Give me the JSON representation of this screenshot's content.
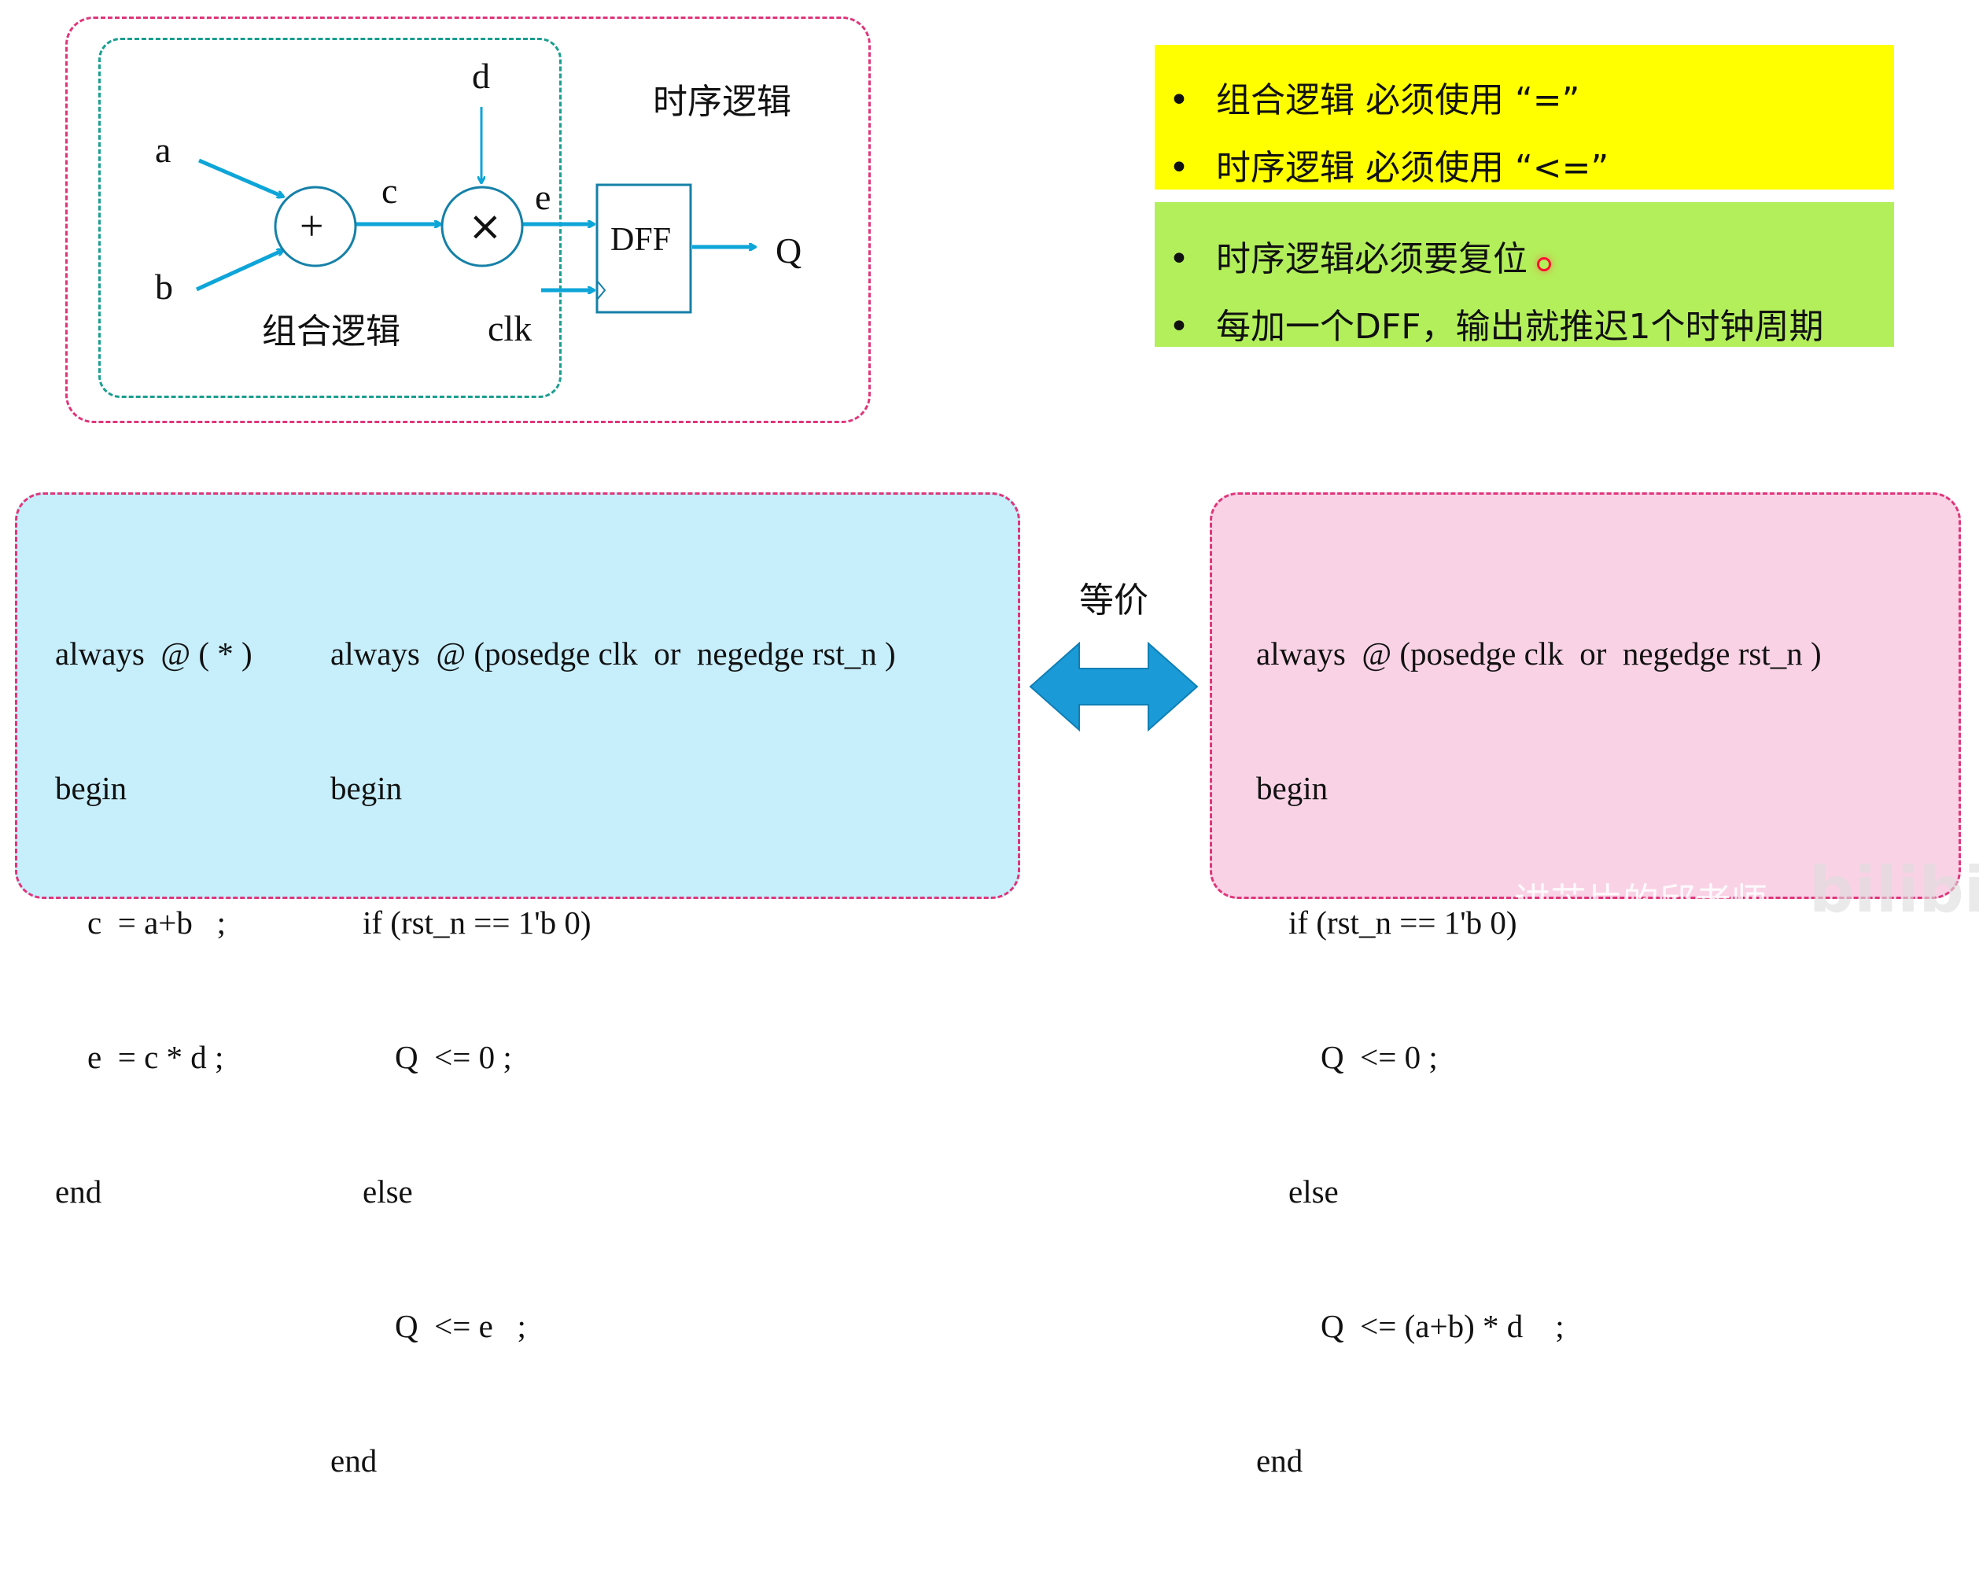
{
  "diagram": {
    "inputs": {
      "a": "a",
      "b": "b",
      "c": "c",
      "d": "d",
      "e": "e",
      "clk": "clk",
      "q": "Q"
    },
    "adder_symbol": "+",
    "multiplier_symbol": "×",
    "dff_label": "DFF",
    "combinational_label": "组合逻辑",
    "sequential_label": "时序逻辑"
  },
  "notes": {
    "yellow": [
      "组合逻辑 必须使用 “=”",
      "时序逻辑 必须使用 “<=”"
    ],
    "green": [
      "时序逻辑必须要复位",
      "每加一个DFF，输出就推迟1个时钟周期"
    ],
    "bullet": "•",
    "colors": {
      "yellow": "#ffff00",
      "green": "#b3ef5a"
    }
  },
  "left_code": {
    "comb": [
      "always  @ ( * )",
      "begin",
      "    c  = a+b   ;",
      "    e  = c * d ;",
      "end"
    ],
    "seq": [
      "always  @ (posedge clk  or  negedge rst_n )",
      "begin",
      "    if (rst_n == 1'b 0)",
      "        Q  <= 0 ;",
      "    else",
      "        Q  <= e   ;",
      "end"
    ]
  },
  "equivalent_label": "等价",
  "right_code": [
    "always  @ (posedge clk  or  negedge rst_n )",
    "begin",
    "    if (rst_n == 1'b 0)",
    "        Q  <= 0 ;",
    "    else",
    "        Q  <= (a+b) * d    ;",
    "end"
  ],
  "watermark": "讲芯片的邱老师",
  "logo": "bilibili",
  "colors": {
    "wire": "#0ea5d8",
    "pink_dash": "#e0357a",
    "teal_dash": "#1a9e8f",
    "left_bg": "#c6eefb",
    "right_bg": "#f9d3e5"
  }
}
